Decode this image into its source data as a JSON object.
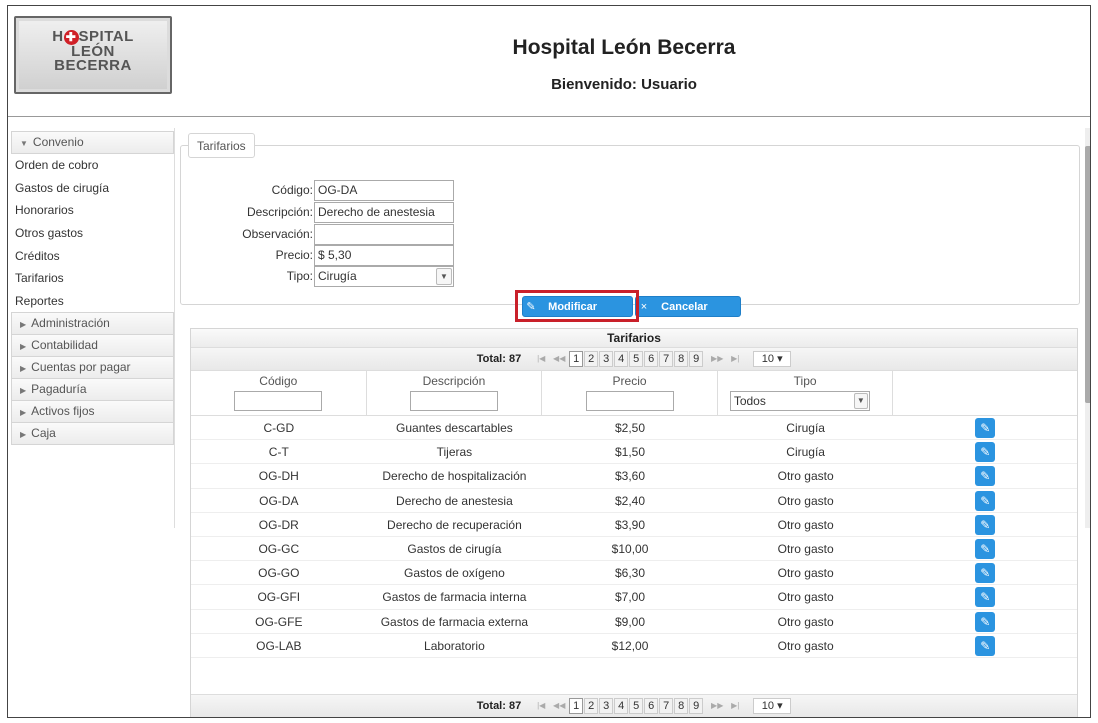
{
  "header": {
    "logo_text": "HOSPITAL LEÓN BECERRA",
    "title": "Hospital León Becerra",
    "welcome": "Bienvenido: Usuario"
  },
  "sidebar": {
    "sections": [
      {
        "label": "Convenio",
        "expanded": true
      },
      {
        "label": "Administración"
      },
      {
        "label": "Contabilidad"
      },
      {
        "label": "Cuentas por pagar"
      },
      {
        "label": "Pagaduría"
      },
      {
        "label": "Activos fijos"
      },
      {
        "label": "Caja"
      }
    ],
    "convenio_items": [
      "Orden de cobro",
      "Gastos de cirugía",
      "Honorarios",
      "Otros gastos",
      "Créditos",
      "Tarifarios",
      "Reportes"
    ]
  },
  "form": {
    "legend": "Tarifarios",
    "codigo_label": "Código:",
    "codigo_value": "OG-DA",
    "descripcion_label": "Descripción:",
    "descripcion_value": "Derecho de anestesia",
    "observacion_label": "Observación:",
    "observacion_value": "",
    "precio_label": "Precio:",
    "precio_value": "$ 5,30",
    "tipo_label": "Tipo:",
    "tipo_value": "Cirugía",
    "modificar_label": "Modificar",
    "cancelar_label": "Cancelar"
  },
  "table": {
    "caption": "Tarifarios",
    "total_label": "Total: 87",
    "pages": [
      "1",
      "2",
      "3",
      "4",
      "5",
      "6",
      "7",
      "8",
      "9"
    ],
    "current_page": "1",
    "rows_per_page": "10 ▾",
    "columns": [
      "Código",
      "Descripción",
      "Precio",
      "Tipo"
    ],
    "tipo_filter": "Todos",
    "rows": [
      [
        "C-GD",
        "Guantes descartables",
        "$2,50",
        "Cirugía"
      ],
      [
        "C-T",
        "Tijeras",
        "$1,50",
        "Cirugía"
      ],
      [
        "OG-DH",
        "Derecho de hospitalización",
        "$3,60",
        "Otro gasto"
      ],
      [
        "OG-DA",
        "Derecho de anestesia",
        "$2,40",
        "Otro gasto"
      ],
      [
        "OG-DR",
        "Derecho de recuperación",
        "$3,90",
        "Otro gasto"
      ],
      [
        "OG-GC",
        "Gastos de cirugía",
        "$10,00",
        "Otro gasto"
      ],
      [
        "OG-GO",
        "Gastos de oxígeno",
        "$6,30",
        "Otro gasto"
      ],
      [
        "OG-GFI",
        "Gastos de farmacia interna",
        "$7,00",
        "Otro gasto"
      ],
      [
        "OG-GFE",
        "Gastos de farmacia externa",
        "$9,00",
        "Otro gasto"
      ],
      [
        "OG-LAB",
        "Laboratorio",
        "$12,00",
        "Otro gasto"
      ]
    ]
  },
  "colors": {
    "accent": "#2b94e0",
    "highlight": "#c9202a"
  }
}
